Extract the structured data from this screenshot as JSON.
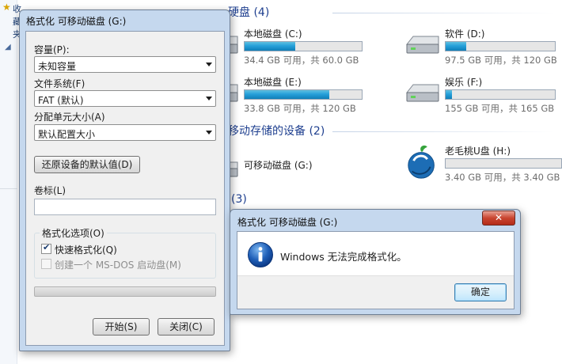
{
  "explorer": {
    "favorites_label": "收藏夹",
    "groups": {
      "hard_disks": "硬盘 (4)",
      "removable": "移动存储的设备 (2)",
      "other": "(3)"
    },
    "drives": [
      {
        "name": "本地磁盘 (C:)",
        "size_text": "34.4 GB 可用，共 60.0 GB",
        "used_fraction": 0.43,
        "icon": "hard-disk-icon"
      },
      {
        "name": "软件 (D:)",
        "size_text": "97.5 GB 可用，共 120 GB",
        "used_fraction": 0.19,
        "icon": "hard-disk-icon"
      },
      {
        "name": "本地磁盘 (E:)",
        "size_text": "33.8 GB 可用，共 120 GB",
        "used_fraction": 0.72,
        "icon": "hard-disk-icon"
      },
      {
        "name": "娱乐 (F:)",
        "size_text": "155 GB 可用，共 165 GB",
        "used_fraction": 0.06,
        "icon": "hard-disk-icon"
      },
      {
        "name": "可移动磁盘 (G:)",
        "icon": "removable-disk-icon"
      },
      {
        "name": "老毛桃U盘 (H:)",
        "size_text": "3.40 GB 可用，共 3.40 GB",
        "used_fraction": 0.0,
        "icon": "peach-usb-icon"
      }
    ]
  },
  "format_dialog": {
    "title": "格式化 可移动磁盘 (G:)",
    "capacity_label": "容量(P):",
    "capacity_value": "未知容量",
    "filesystem_label": "文件系统(F)",
    "filesystem_value": "FAT (默认)",
    "allocation_label": "分配单元大小(A)",
    "allocation_value": "默认配置大小",
    "restore_defaults_button": "还原设备的默认值(D)",
    "volume_label": "卷标(L)",
    "volume_value": "",
    "options_group": "格式化选项(O)",
    "quick_format_label": "快速格式化(Q)",
    "quick_format_checked": true,
    "msdos_label": "创建一个 MS-DOS 启动盘(M)",
    "msdos_checked": false,
    "progress": 0,
    "start_button": "开始(S)",
    "close_button": "关闭(C)"
  },
  "error_dialog": {
    "title": "格式化 可移动磁盘 (G:)",
    "close_glyph": "✕",
    "icon": "info-icon",
    "message": "Windows 无法完成格式化。",
    "ok_button": "确定"
  },
  "colors": {
    "drive_bar": "#26a0da",
    "group_title": "#1e3f8f",
    "window_frame": "#c5d8ee",
    "close_button": "#c94530"
  }
}
